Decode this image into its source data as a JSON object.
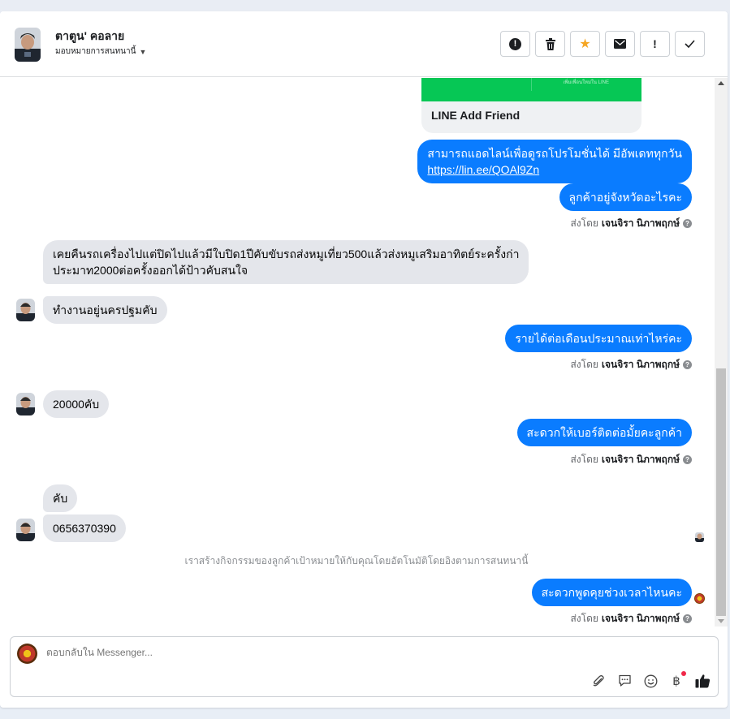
{
  "header": {
    "name": "ตาตูน' คอลาย",
    "assign_label": "มอบหมายการสนทนานี้"
  },
  "actions": [
    {
      "name": "spam-button",
      "icon": "alert-circle-icon"
    },
    {
      "name": "delete-button",
      "icon": "trash-icon"
    },
    {
      "name": "star-button",
      "icon": "star-icon"
    },
    {
      "name": "mark-unread-button",
      "icon": "envelope-icon"
    },
    {
      "name": "follow-up-button",
      "icon": "exclamation-icon"
    },
    {
      "name": "done-button",
      "icon": "check-icon"
    }
  ],
  "line_card": {
    "title": "LINE Add Friend",
    "fine_print": "เพิ่มเพื่อนใหม่ใน LINE"
  },
  "messages": {
    "m1_line1": "สามารถแอดไลน์เพื่อดูรถโปรโมชั่นได้ มีอัพเดททุกวัน",
    "m1_link": "https://lin.ee/QOAl9Zn",
    "m2": "ลูกค้าอยู่จังหวัดอะไรคะ",
    "m3_line1": "เคยคืนรถเครื่องไปแต่ปิดไปแล้วมีใบปิด1ปีคับขับรถส่งหมูเที่ยว500แล้วส่งหมูเสริมอาทิตย์ระครั้งก่า",
    "m3_line2": "ประมาท2000ต่อครั้งออกได้ป้าวคับสนใจ",
    "m4": "ทำงานอยู่นครปฐมคับ",
    "m5": "รายได้ต่อเดือนประมาณเท่าไหร่คะ",
    "m6": "20000คับ",
    "m7": "สะดวกให้เบอร์ติดต่อมั้ยคะลูกค้า",
    "m8": "คับ",
    "m9": "0656370390",
    "m10": "สะดวกพูดคุยช่วงเวลาไหนคะ"
  },
  "sent_by": {
    "prefix": "ส่งโดย",
    "agent": "เจนจิรา นิภาพฤกษ์"
  },
  "system_note": "เราสร้างกิจกรรมของลูกค้าเป้าหมายให้กับคุณโดยอัตโนมัติโดยอิงตามการสนทนานี้",
  "composer": {
    "placeholder": "ตอบกลับใน Messenger..."
  },
  "colors": {
    "outgoing_bubble": "#0a7cff",
    "incoming_bubble": "#e4e6eb",
    "line_green": "#06c755",
    "star": "#f5a623"
  }
}
